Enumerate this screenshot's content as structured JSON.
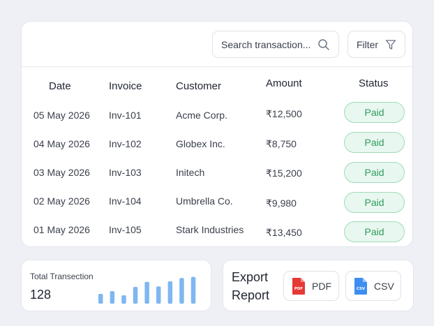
{
  "search": {
    "placeholder": "Search transaction..."
  },
  "filter": {
    "label": "Filter"
  },
  "table": {
    "headers": {
      "date": "Date",
      "invoice": "Invoice",
      "customer": "Customer",
      "amount": "Amount",
      "status": "Status"
    },
    "rows": [
      {
        "date": "05 May 2026",
        "invoice": "Inv-101",
        "customer": "Acme Corp.",
        "amount": "₹12,500",
        "status": "Paid"
      },
      {
        "date": "04 May 2026",
        "invoice": "Inv-102",
        "customer": "Globex Inc.",
        "amount": "₹8,750",
        "status": "Paid"
      },
      {
        "date": "03 May 2026",
        "invoice": "Inv-103",
        "customer": "Initech",
        "amount": "₹15,200",
        "status": "Paid"
      },
      {
        "date": "02 May 2026",
        "invoice": "Inv-104",
        "customer": "Umbrella Co.",
        "amount": "₹9,980",
        "status": "Paid"
      },
      {
        "date": "01 May 2026",
        "invoice": "Inv-105",
        "customer": "Stark Industries",
        "amount": "₹13,450",
        "status": "Paid"
      }
    ]
  },
  "stats": {
    "label": "Total Transection",
    "value": "128",
    "bars": [
      0.35,
      0.45,
      0.3,
      0.6,
      0.78,
      0.62,
      0.8,
      0.92,
      0.96
    ],
    "bar_color": "#7fb7f0"
  },
  "export": {
    "title": "Export Report",
    "pdf": {
      "label": "PDF",
      "icon": "pdf-file-icon",
      "color": "#e53935"
    },
    "csv": {
      "label": "CSV",
      "icon": "csv-file-icon",
      "color": "#3d8ef0"
    }
  },
  "colors": {
    "paid_bg": "#e8f7ef",
    "paid_border": "#9fdcb9",
    "paid_text": "#2f9b5f"
  }
}
